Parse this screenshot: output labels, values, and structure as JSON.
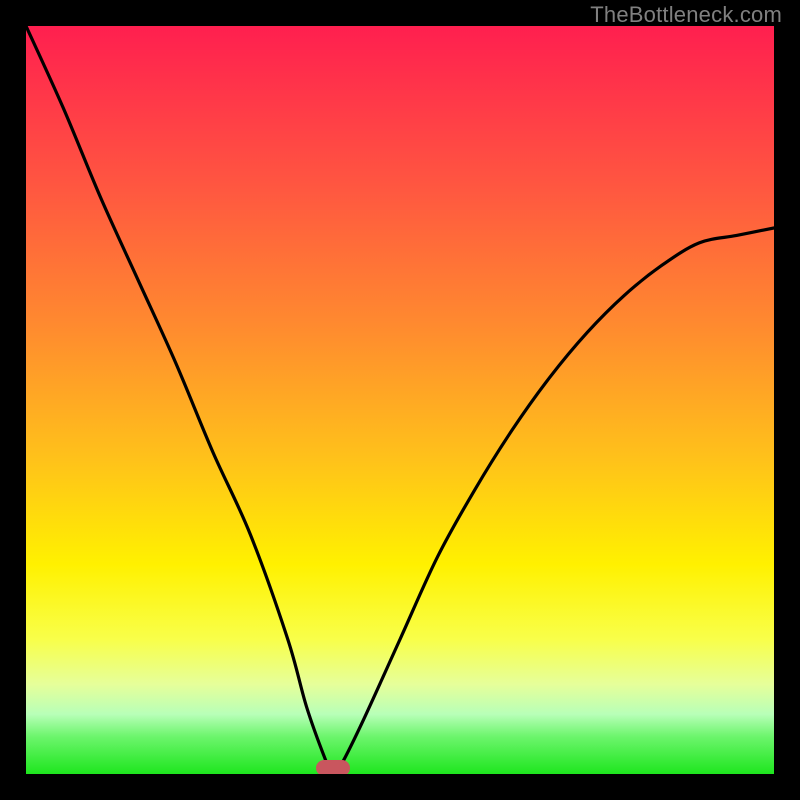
{
  "watermark": "TheBottleneck.com",
  "chart_data": {
    "type": "line",
    "title": "",
    "xlabel": "",
    "ylabel": "",
    "xlim": [
      0,
      1
    ],
    "ylim": [
      0,
      1
    ],
    "legend": false,
    "grid": false,
    "background": "rainbow-vertical-gradient (red→orange→yellow→green)",
    "series": [
      {
        "name": "bottleneck-curve",
        "stroke": "#000000",
        "x": [
          0.0,
          0.05,
          0.1,
          0.15,
          0.2,
          0.25,
          0.3,
          0.35,
          0.375,
          0.4,
          0.41,
          0.42,
          0.45,
          0.5,
          0.55,
          0.6,
          0.65,
          0.7,
          0.75,
          0.8,
          0.85,
          0.9,
          0.95,
          1.0
        ],
        "y": [
          1.0,
          0.89,
          0.77,
          0.66,
          0.55,
          0.43,
          0.32,
          0.18,
          0.09,
          0.02,
          0.0,
          0.01,
          0.07,
          0.18,
          0.29,
          0.38,
          0.46,
          0.53,
          0.59,
          0.64,
          0.68,
          0.71,
          0.72,
          0.73
        ],
        "notch_x": 0.41
      }
    ],
    "marker": {
      "shape": "rounded-rect",
      "x": 0.41,
      "y": 0.0,
      "color": "#c9565e"
    }
  },
  "geom": {
    "stage_w": 800,
    "stage_h": 800,
    "border": 26
  }
}
